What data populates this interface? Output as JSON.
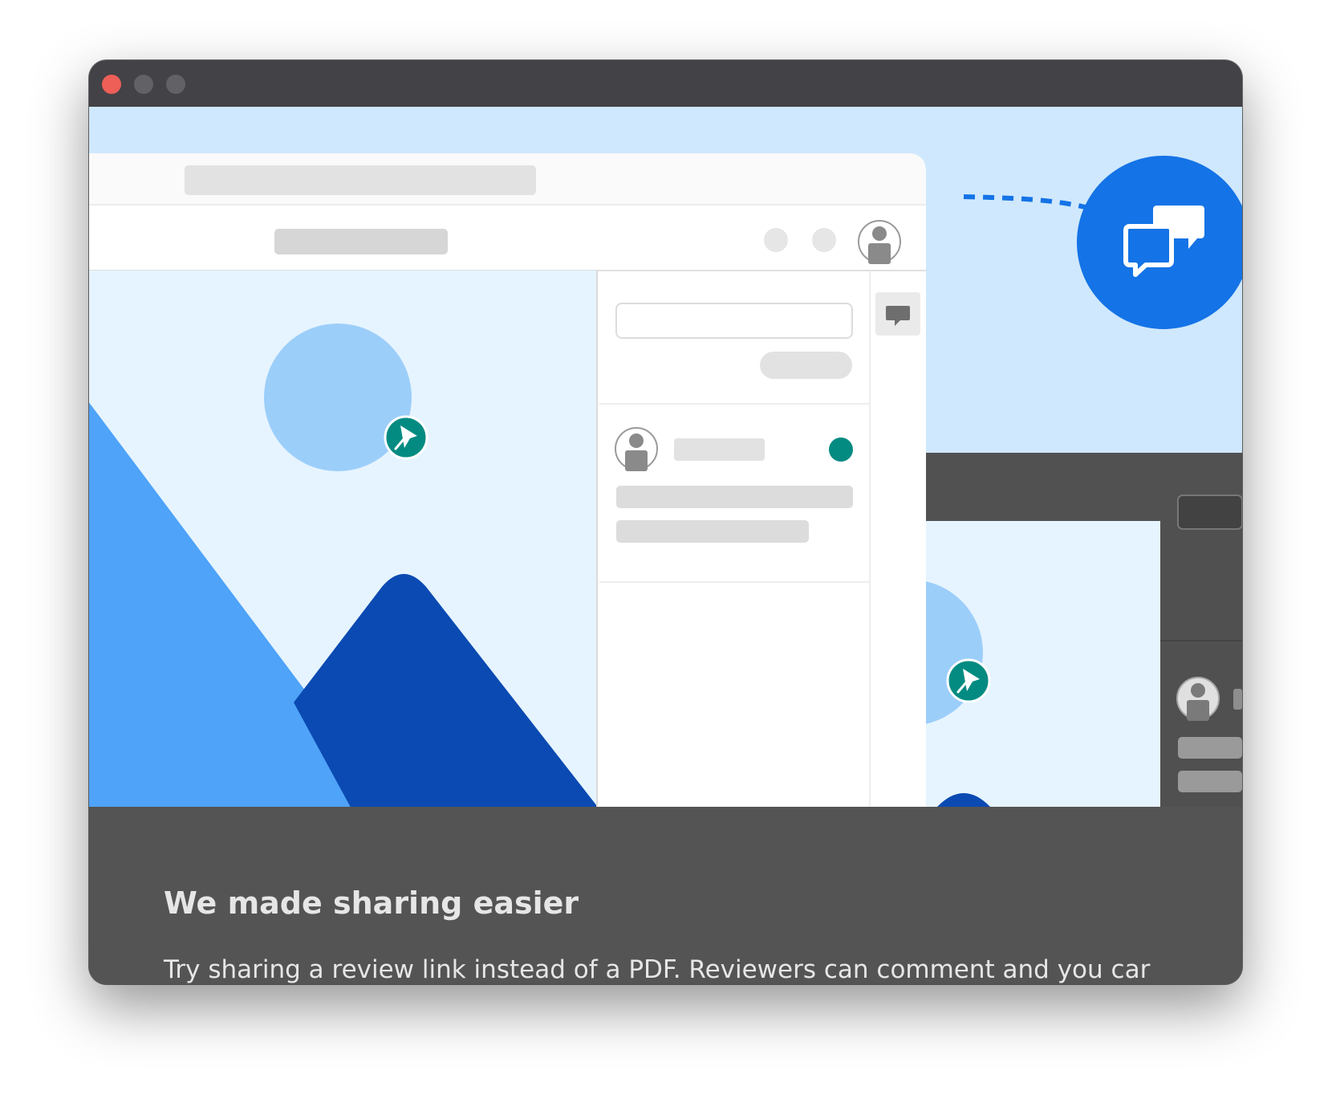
{
  "window": {
    "controls": [
      "close-button",
      "minimize-button",
      "maximize-button"
    ],
    "colors": {
      "titlebar": "#434246",
      "panel": "#545454",
      "hero_background": "#cfe8fd",
      "accent_blue": "#1473e6",
      "pin_teal": "#038b82"
    }
  },
  "illustration": {
    "icons": [
      "comments-icon",
      "comment-icon",
      "user-icon",
      "pin-icon",
      "status-dot"
    ]
  },
  "content": {
    "heading": "We made sharing easier",
    "body": "Try sharing a review link instead of a PDF. Reviewers can comment and you car"
  }
}
